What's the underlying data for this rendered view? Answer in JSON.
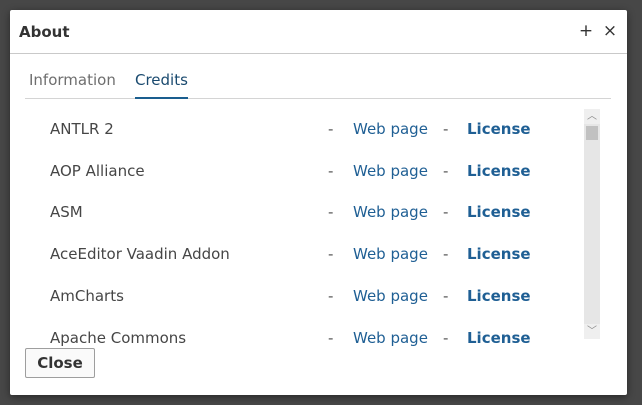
{
  "dialog": {
    "title": "About",
    "maximize_icon": "+",
    "close_icon": "×"
  },
  "tabs": [
    {
      "label": "Information",
      "active": false
    },
    {
      "label": "Credits",
      "active": true
    }
  ],
  "credits": [
    {
      "name": "ANTLR 2",
      "web": "Web page",
      "license": "License"
    },
    {
      "name": "AOP Alliance",
      "web": "Web page",
      "license": "License"
    },
    {
      "name": "ASM",
      "web": "Web page",
      "license": "License"
    },
    {
      "name": "AceEditor Vaadin Addon",
      "web": "Web page",
      "license": "License"
    },
    {
      "name": "AmCharts",
      "web": "Web page",
      "license": "License"
    },
    {
      "name": "Apache Commons",
      "web": "Web page",
      "license": "License"
    }
  ],
  "separator": "-",
  "scrollbar": {
    "up_icon": "︿",
    "down_icon": "﹀"
  },
  "footer": {
    "close_label": "Close"
  },
  "colors": {
    "link": "#1f5f94",
    "backdrop": "#474747",
    "tab_active": "#1a5e8f"
  }
}
